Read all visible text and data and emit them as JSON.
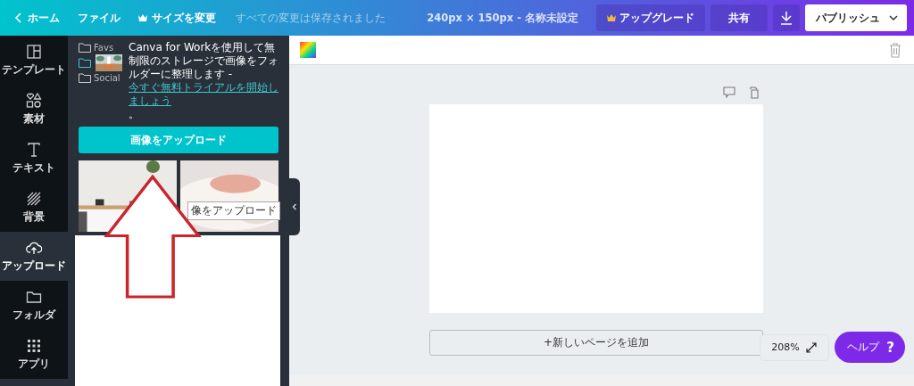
{
  "topbar": {
    "home": "ホーム",
    "file": "ファイル",
    "resize": "サイズを変更",
    "save_status": "すべての変更は保存されました",
    "doc_info": "240px × 150px - 名称未設定",
    "upgrade": "アップグレード",
    "share": "共有",
    "publish": "パブリッシュ"
  },
  "rail": [
    {
      "label": "テンプレート",
      "selected": false
    },
    {
      "label": "素材",
      "selected": false
    },
    {
      "label": "テキスト",
      "selected": false
    },
    {
      "label": "背景",
      "selected": false
    },
    {
      "label": "アップロード",
      "selected": true
    },
    {
      "label": "フォルダ",
      "selected": false
    },
    {
      "label": "アプリ",
      "selected": false
    }
  ],
  "panel": {
    "folders": [
      {
        "kind": "folder",
        "label": "Favs"
      },
      {
        "kind": "folder"
      },
      {
        "kind": "folder",
        "label": "Social"
      }
    ],
    "promo_text": "Canva for Workを使用して無制限のストレージで画像をフォルダーに整理します - ",
    "promo_link": "今すぐ無料トライアルを開始しましょう",
    "promo_end": "。",
    "upload_button": "画像をアップロード",
    "tooltip": "像をアップロード"
  },
  "canvas": {
    "add_page": "+新しいページを追加",
    "zoom": "208%",
    "help": "ヘルプ",
    "help_icon": "?"
  }
}
